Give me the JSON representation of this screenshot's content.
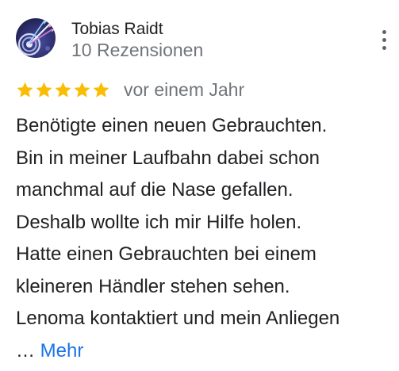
{
  "reviewer": {
    "name": "Tobias Raidt",
    "review_count": "10 Rezensionen",
    "avatar_icon": "arrows-target-avatar"
  },
  "menu": {
    "icon": "more-vertical-icon"
  },
  "review": {
    "rating": 5,
    "max_rating": 5,
    "star_color": "#fbbc04",
    "date": "vor einem Jahr",
    "lines": [
      "Benötigte einen neuen Gebrauchten.",
      "Bin in meiner Laufbahn dabei schon",
      "manchmal auf die Nase gefallen.",
      "Deshalb wollte ich mir Hilfe holen.",
      "Hatte einen Gebrauchten bei einem",
      "kleineren Händler stehen sehen.",
      "Lenoma kontaktiert und mein Anliegen"
    ],
    "ellipsis": "…",
    "more_label": "Mehr"
  },
  "colors": {
    "text_primary": "#202124",
    "text_secondary": "#70757a",
    "link": "#1a73e8"
  }
}
